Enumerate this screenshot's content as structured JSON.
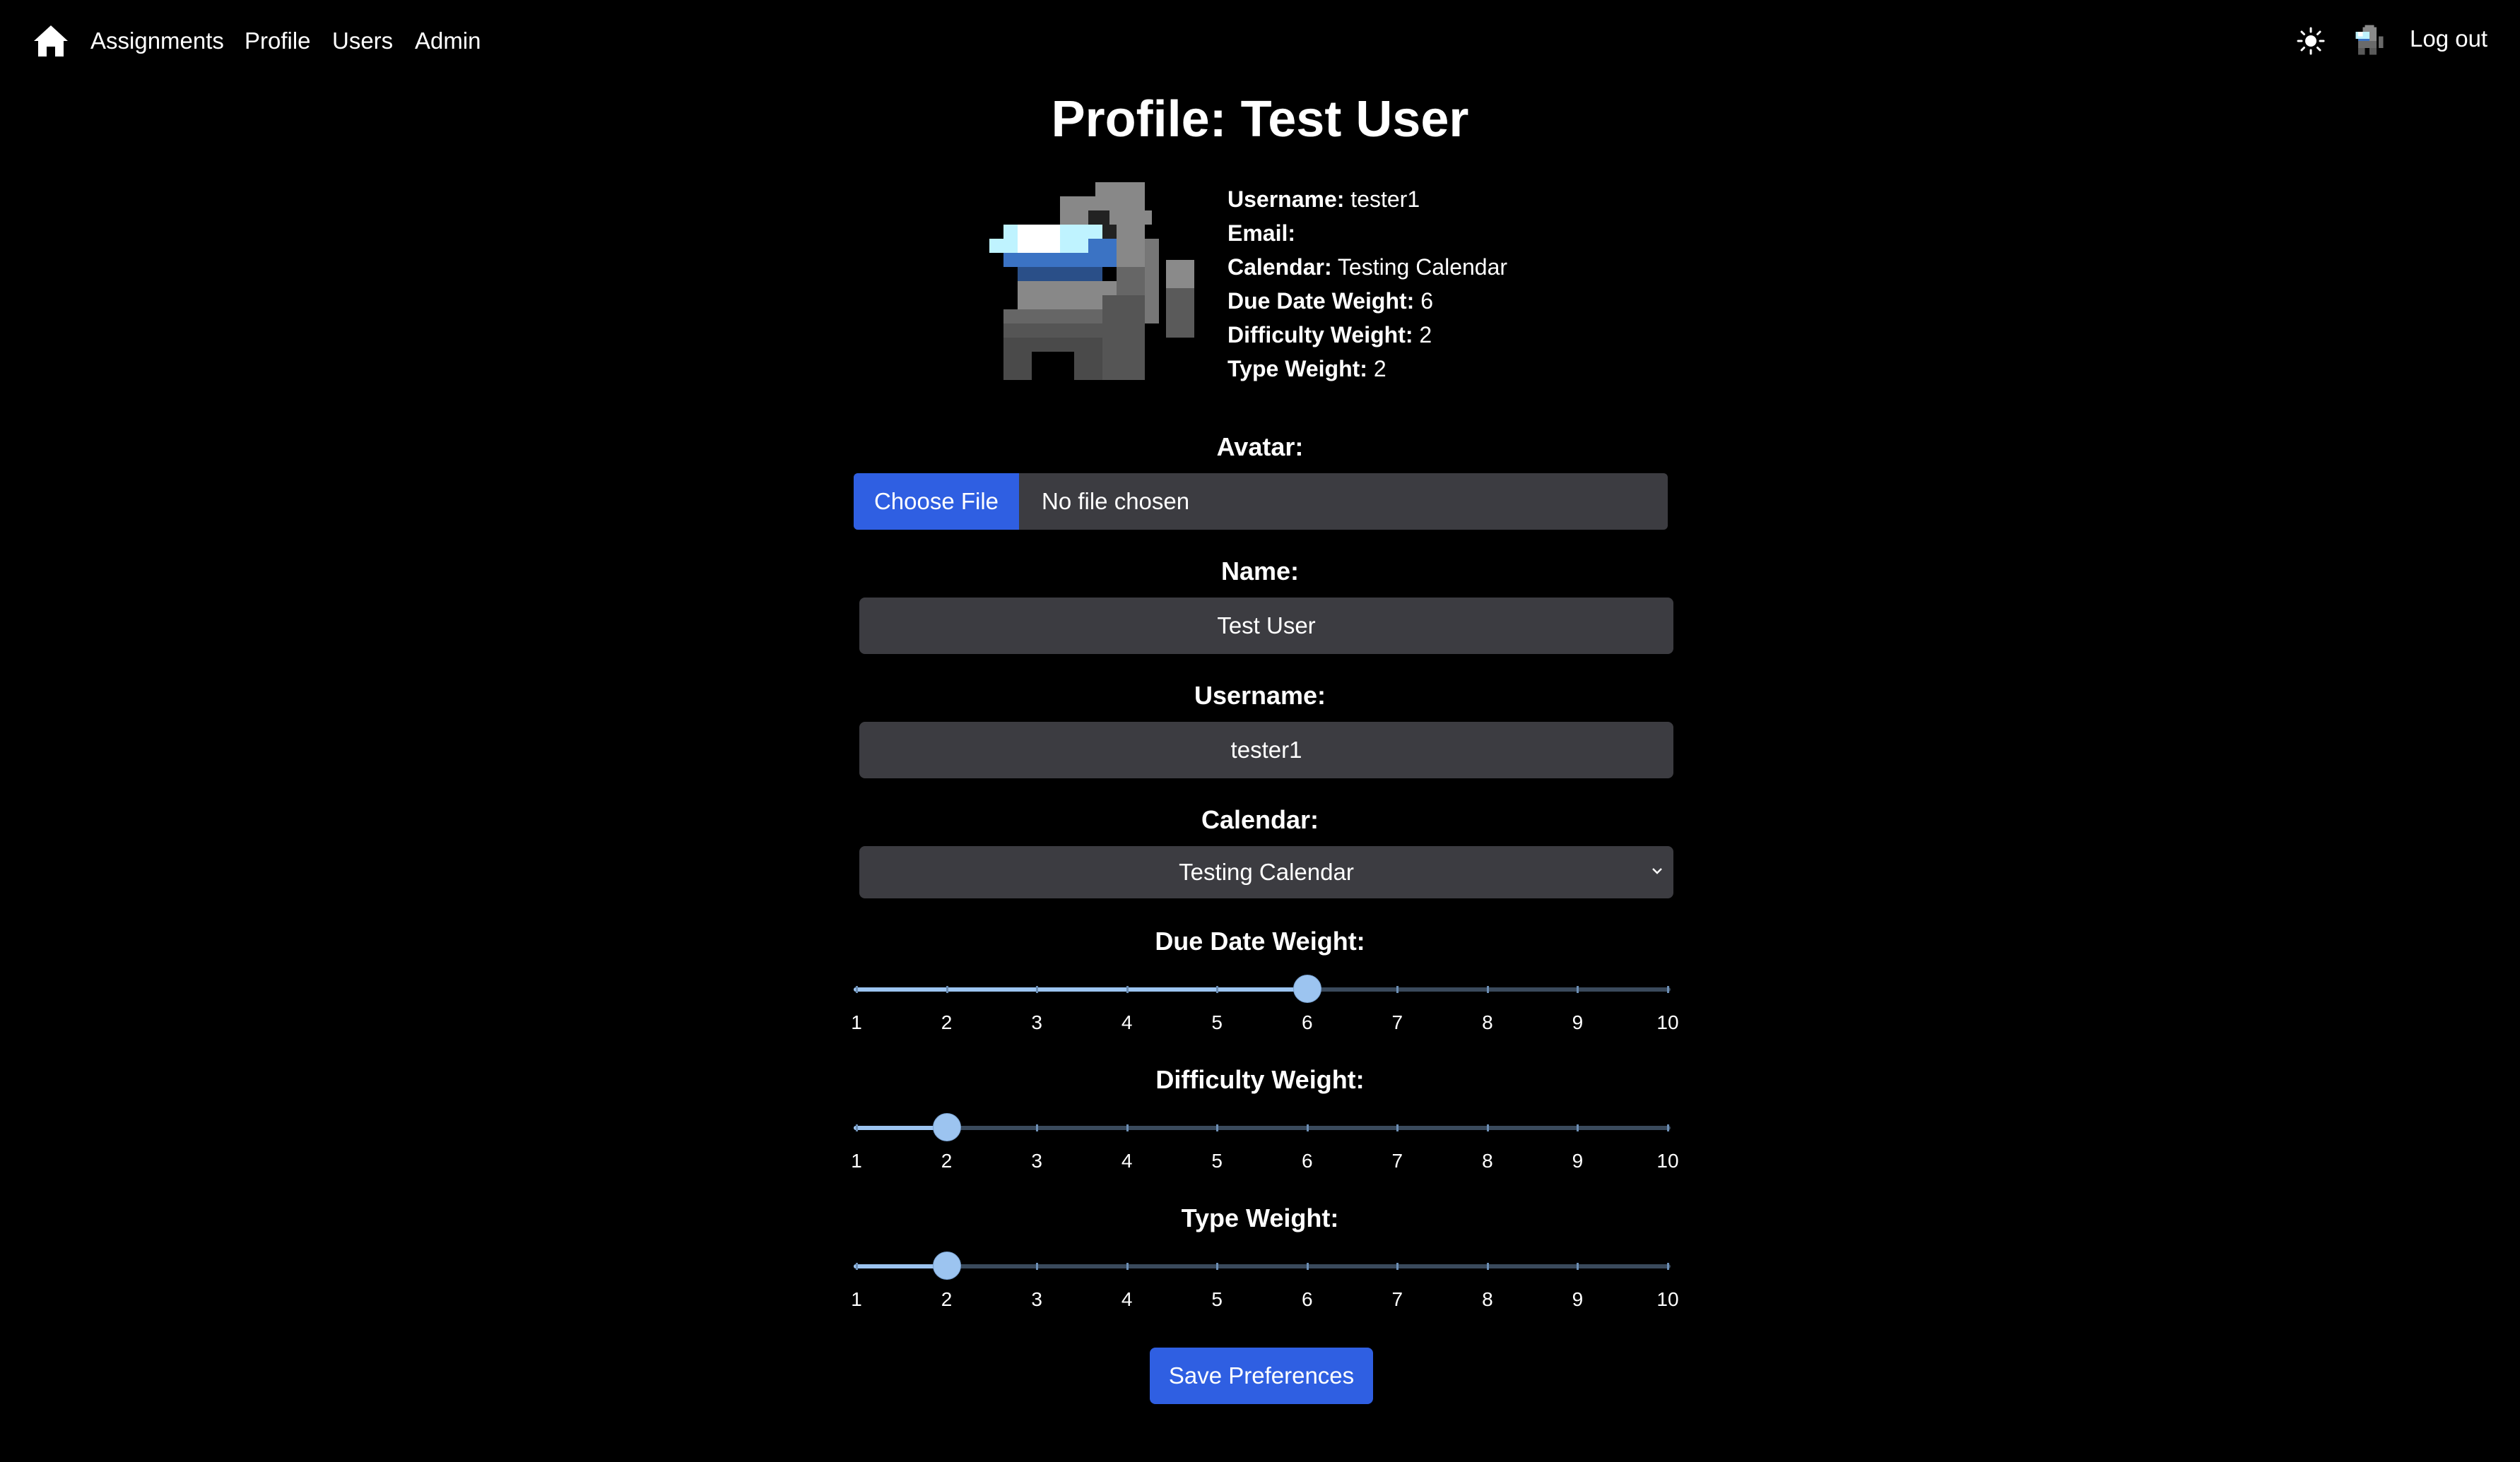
{
  "nav": {
    "links": [
      "Assignments",
      "Profile",
      "Users",
      "Admin"
    ],
    "logout": "Log out",
    "home_icon": "home-icon",
    "theme_icon": "sun-icon"
  },
  "page": {
    "title": "Profile: Test User"
  },
  "info": {
    "username_label": "Username:",
    "username_value": "tester1",
    "email_label": "Email:",
    "email_value": "",
    "calendar_label": "Calendar:",
    "calendar_value": "Testing Calendar",
    "due_label": "Due Date Weight:",
    "due_value": "6",
    "difficulty_label": "Difficulty Weight:",
    "difficulty_value": "2",
    "type_label": "Type Weight:",
    "type_value": "2"
  },
  "form": {
    "avatar_label": "Avatar:",
    "choose_file": "Choose File",
    "no_file": "No file chosen",
    "name_label": "Name:",
    "name_value": "Test User",
    "username_label": "Username:",
    "username_value": "tester1",
    "calendar_label": "Calendar:",
    "calendar_value": "Testing Calendar",
    "due_label": "Due Date Weight:",
    "difficulty_label": "Difficulty Weight:",
    "type_label": "Type Weight:",
    "save": "Save Preferences"
  },
  "sliders": {
    "scale": [
      "1",
      "2",
      "3",
      "4",
      "5",
      "6",
      "7",
      "8",
      "9",
      "10"
    ],
    "due": 6,
    "difficulty": 2,
    "type": 2
  },
  "colors": {
    "accent": "#2f5fe2",
    "field_bg": "#3c3c41",
    "slider_fill": "#9cc4f0"
  }
}
